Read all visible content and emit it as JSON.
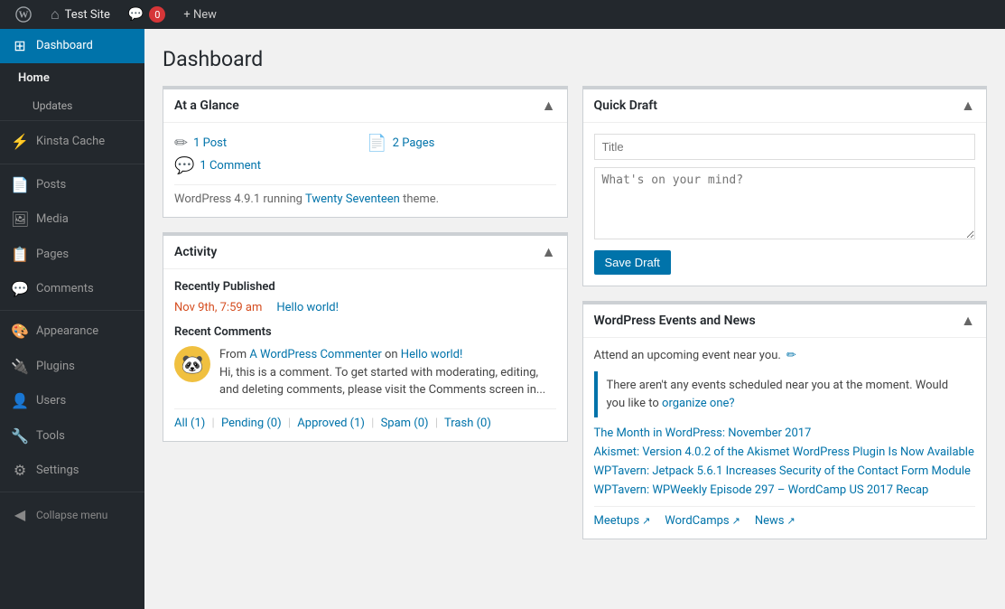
{
  "adminbar": {
    "wp_logo": "⚙",
    "site_name": "Test Site",
    "comment_icon": "💬",
    "comment_count": "0",
    "new_label": "+ New"
  },
  "sidebar": {
    "dashboard_label": "Dashboard",
    "home_label": "Home",
    "updates_label": "Updates",
    "kinsta_cache_label": "Kinsta Cache",
    "posts_label": "Posts",
    "media_label": "Media",
    "pages_label": "Pages",
    "comments_label": "Comments",
    "appearance_label": "Appearance",
    "plugins_label": "Plugins",
    "users_label": "Users",
    "tools_label": "Tools",
    "settings_label": "Settings",
    "collapse_label": "Collapse menu"
  },
  "page": {
    "title": "Dashboard"
  },
  "at_a_glance": {
    "title": "At a Glance",
    "post_count": "1 Post",
    "page_count": "2 Pages",
    "comment_count": "1 Comment",
    "wp_info": "WordPress 4.9.1 running ",
    "theme_name": "Twenty Seventeen",
    "theme_suffix": " theme."
  },
  "activity": {
    "title": "Activity",
    "recently_published": "Recently Published",
    "post_date": "Nov 9th, 7:59 am",
    "post_title": "Hello world!",
    "recent_comments": "Recent Comments",
    "comment_from": "From ",
    "commenter_name": "A WordPress Commenter",
    "comment_on": " on ",
    "comment_post": "Hello world!",
    "comment_body": "Hi, this is a comment. To get started with moderating, editing, and deleting comments, please visit the Comments screen in...",
    "footer_all": "All (1)",
    "footer_pending": "Pending (0)",
    "footer_approved": "Approved (1)",
    "footer_spam": "Spam (0)",
    "footer_trash": "Trash (0)"
  },
  "quick_draft": {
    "title": "Quick Draft",
    "title_placeholder": "Title",
    "content_placeholder": "What's on your mind?",
    "save_label": "Save Draft"
  },
  "events_news": {
    "title": "WordPress Events and News",
    "attend_text": "Attend an upcoming event near you.",
    "no_events_text": "There aren't any events scheduled near you at the moment. Would you like to ",
    "organize_link": "organize one?",
    "news_1": "The Month in WordPress: November 2017",
    "news_2": "Akismet: Version 4.0.2 of the Akismet WordPress Plugin Is Now Available",
    "news_3": "WPTavern: Jetpack 5.6.1 Increases Security of the Contact Form Module",
    "news_4": "WPTavern: WPWeekly Episode 297 – WordCamp US 2017 Recap",
    "meetups_label": "Meetups",
    "wordcamps_label": "WordCamps",
    "news_label": "News"
  }
}
